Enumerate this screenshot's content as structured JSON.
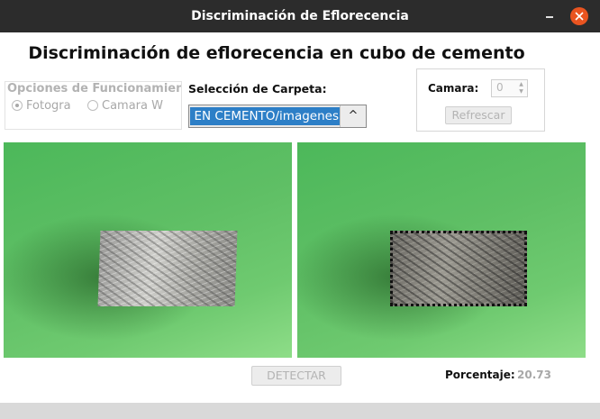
{
  "window": {
    "title": "Discriminación de Eflorecencia"
  },
  "header": {
    "title": "Discriminación de eflorecencia en cubo de cemento"
  },
  "options_group": {
    "label": "Opciones de Funcionamient",
    "radios": [
      {
        "label": "Fotogra",
        "checked": true
      },
      {
        "label": "Camara W",
        "checked": false
      }
    ]
  },
  "folder": {
    "label": "Selección de Carpeta:",
    "value": "EN CEMENTO/imagenes",
    "arrow": "^"
  },
  "camera": {
    "label": "Camara:",
    "value": "0",
    "refresh_label": "Refrescar"
  },
  "actions": {
    "detect_label": "DETECTAR"
  },
  "result": {
    "label": "Porcentaje:",
    "value": "20.73"
  },
  "colors": {
    "titlebar": "#2c2c2c",
    "close_button": "#e95420",
    "selection": "#2d7fc7",
    "image_background": "#5fbf65"
  }
}
